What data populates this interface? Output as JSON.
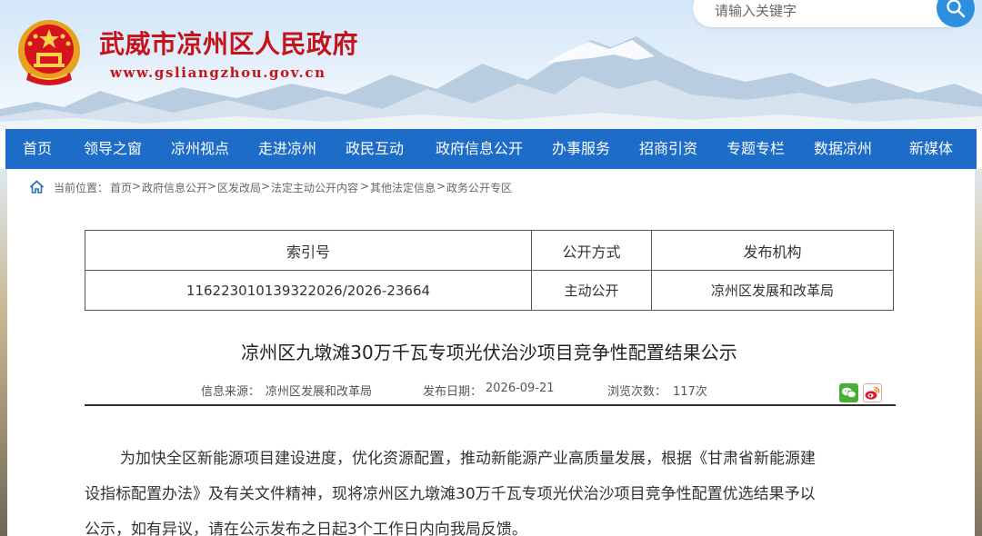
{
  "header": {
    "site_title": "武威市凉州区人民政府",
    "site_url": "www.gsliangzhou.gov.cn",
    "emblem_icon": "national-emblem-icon",
    "search": {
      "placeholder": "请输入关键字",
      "button_icon": "search-icon"
    }
  },
  "nav": {
    "items": [
      "首页",
      "领导之窗",
      "凉州视点",
      "走进凉州",
      "政民互动",
      "政府信息公开",
      "办事服务",
      "招商引资",
      "专题专栏",
      "数据凉州",
      "新媒体"
    ],
    "bg_color": "#1c6cc8"
  },
  "breadcrumb": {
    "label": "当前位置：",
    "items": [
      "首页",
      "政府信息公开",
      "区发改局",
      "法定主动公开内容",
      "其他法定信息",
      "政务公开专区"
    ],
    "separator": ">",
    "icon": "home-icon"
  },
  "info_table": {
    "headers": [
      "索引号",
      "公开方式",
      "发布机构"
    ],
    "values": [
      "116223010139322026/2026-23664",
      "主动公开",
      "凉州区发展和改革局"
    ]
  },
  "article": {
    "title": "凉州区九墩滩30万千瓦专项光伏治沙项目竞争性配置结果公示",
    "source_label": "信息来源：",
    "source": "凉州区发展和改革局",
    "date_label": "发布日期：",
    "date": "2026-09-21",
    "views_label": "浏览次数：",
    "views": "117次",
    "share_icons": [
      "wechat-icon",
      "weibo-icon"
    ],
    "body_lines": [
      "为加快全区新能源项目建设进度，优化资源配置，推动新能源产业高质量发展，根据《甘肃省新能源建",
      "设指标配置办法》及有关文件精神，现将凉州区九墩滩30万千瓦专项光伏治沙项目竞争性配置优选结果予以",
      "公示，如有异议，请在公示发布之日起3个工作日内向我局反馈。"
    ]
  }
}
